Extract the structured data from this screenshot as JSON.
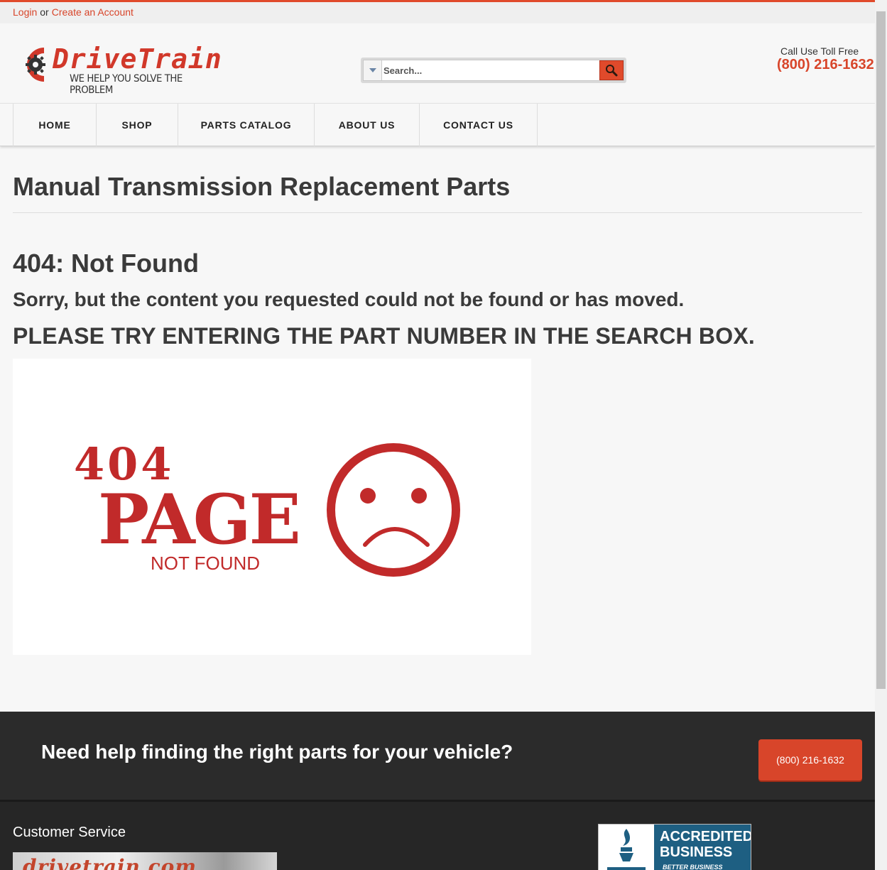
{
  "topbar": {
    "login": "Login",
    "or": "or",
    "create_account": "Create an Account"
  },
  "logo": {
    "name": "DriveTrain",
    "tagline": "WE HELP YOU SOLVE THE PROBLEM"
  },
  "search": {
    "placeholder": "Search...",
    "dropdown_icon": "chevron-down-icon",
    "button_icon": "search-icon"
  },
  "call": {
    "label": "Call Use Toll Free",
    "phone": "(800) 216-1632"
  },
  "nav": {
    "items": [
      "HOME",
      "SHOP",
      "PARTS CATALOG",
      "ABOUT US",
      "CONTACT US"
    ]
  },
  "page": {
    "title": "Manual Transmission Replacement Parts",
    "error_heading": "404: Not Found",
    "error_message": "Sorry, but the content you requested could not be found or has moved.",
    "error_hint": "PLEASE TRY ENTERING THE PART NUMBER IN THE SEARCH BOX."
  },
  "error_image": {
    "code": "404",
    "word": "PAGE",
    "subtext": "NOT FOUND",
    "icon": "sad-face-icon",
    "color": "#c12a2a"
  },
  "cta": {
    "text": "Need help finding the right parts for your vehicle?",
    "button": "(800) 216-1632"
  },
  "footer": {
    "customer_service": "Customer Service",
    "banner_text": "drivetrain.com",
    "bbb": {
      "line1": "ACCREDITED",
      "line2": "BUSINESS",
      "line3": "BETTER BUSINESS BUREAU"
    }
  },
  "colors": {
    "accent": "#d8452a",
    "dark": "#2b2b2b",
    "text": "#3a3a3a",
    "bbb_blue": "#1e5f82"
  }
}
